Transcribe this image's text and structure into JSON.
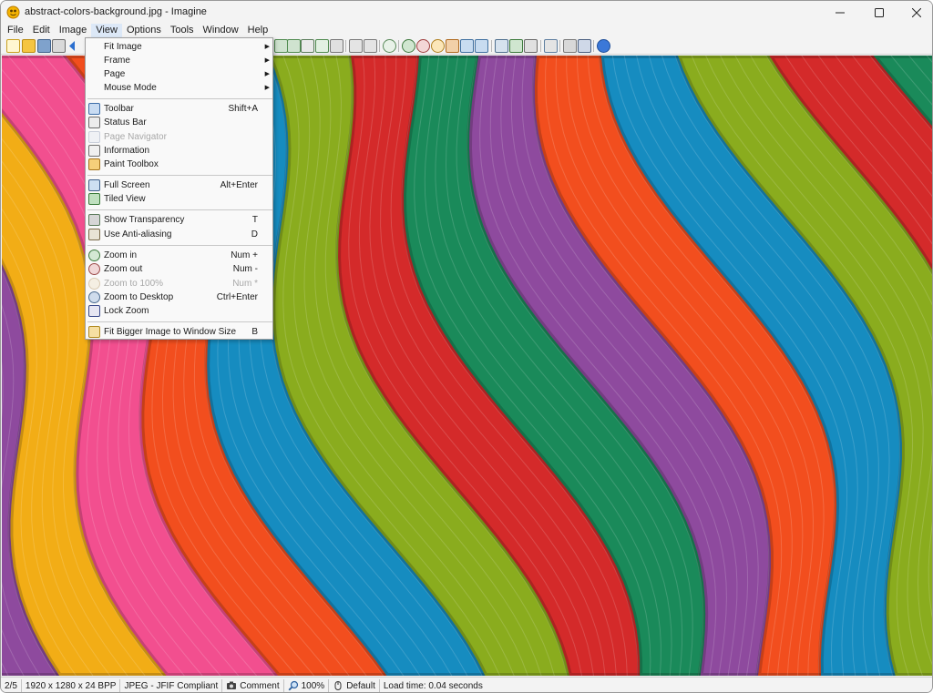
{
  "window": {
    "title": "abstract-colors-background.jpg - Imagine"
  },
  "menubar": {
    "items": [
      "File",
      "Edit",
      "Image",
      "View",
      "Options",
      "Tools",
      "Window",
      "Help"
    ],
    "active": "View"
  },
  "view_menu": {
    "items": [
      {
        "label": "Fit Image",
        "shortcut": "",
        "submenu": true,
        "enabled": true,
        "icon": "none"
      },
      {
        "label": "Frame",
        "shortcut": "",
        "submenu": true,
        "enabled": true,
        "icon": "none"
      },
      {
        "label": "Page",
        "shortcut": "",
        "submenu": true,
        "enabled": true,
        "icon": "none"
      },
      {
        "label": "Mouse Mode",
        "shortcut": "",
        "submenu": true,
        "enabled": true,
        "icon": "none"
      },
      {
        "label": "Toolbar",
        "shortcut": "Shift+A",
        "submenu": false,
        "enabled": true,
        "icon": "toolbar-icon"
      },
      {
        "label": "Status Bar",
        "shortcut": "",
        "submenu": false,
        "enabled": true,
        "icon": "status-bar-icon"
      },
      {
        "label": "Page Navigator",
        "shortcut": "",
        "submenu": false,
        "enabled": false,
        "icon": "page-navigator-icon"
      },
      {
        "label": "Information",
        "shortcut": "",
        "submenu": false,
        "enabled": true,
        "icon": "information-icon"
      },
      {
        "label": "Paint Toolbox",
        "shortcut": "",
        "submenu": false,
        "enabled": true,
        "icon": "paint-palette-icon"
      },
      {
        "label": "Full Screen",
        "shortcut": "Alt+Enter",
        "submenu": false,
        "enabled": true,
        "icon": "monitor-icon"
      },
      {
        "label": "Tiled View",
        "shortcut": "",
        "submenu": false,
        "enabled": true,
        "icon": "tiles-icon"
      },
      {
        "label": "Show Transparency",
        "shortcut": "T",
        "submenu": false,
        "enabled": true,
        "icon": "transparency-icon"
      },
      {
        "label": "Use Anti-aliasing",
        "shortcut": "D",
        "submenu": false,
        "enabled": true,
        "icon": "anti-aliasing-icon"
      },
      {
        "label": "Zoom in",
        "shortcut": "Num +",
        "submenu": false,
        "enabled": true,
        "icon": "zoom-in-icon"
      },
      {
        "label": "Zoom out",
        "shortcut": "Num -",
        "submenu": false,
        "enabled": true,
        "icon": "zoom-out-icon"
      },
      {
        "label": "Zoom to 100%",
        "shortcut": "Num *",
        "submenu": false,
        "enabled": false,
        "icon": "zoom-100-icon"
      },
      {
        "label": "Zoom to Desktop",
        "shortcut": "Ctrl+Enter",
        "submenu": false,
        "enabled": true,
        "icon": "zoom-desktop-icon"
      },
      {
        "label": "Lock Zoom",
        "shortcut": "",
        "submenu": false,
        "enabled": true,
        "icon": "lock-zoom-icon"
      },
      {
        "label": "Fit Bigger Image to Window Size",
        "shortcut": "B",
        "submenu": false,
        "enabled": true,
        "icon": "fit-window-icon"
      }
    ]
  },
  "statusbar": {
    "page": "2/5",
    "dimensions": "1920 x 1280 x 24 BPP",
    "format": "JPEG - JFIF Compliant",
    "comment": "Comment",
    "zoom": "100%",
    "mode": "Default",
    "load_time": "Load time: 0.04 seconds"
  },
  "colors": {
    "menu_highlight": "#dce8f7",
    "stripe_colors": [
      "#d42a2a",
      "#1a8a5a",
      "#8e4a9e",
      "#f2ad16",
      "#f24f8f",
      "#f24e1e",
      "#168cc0",
      "#8aac1e"
    ]
  }
}
